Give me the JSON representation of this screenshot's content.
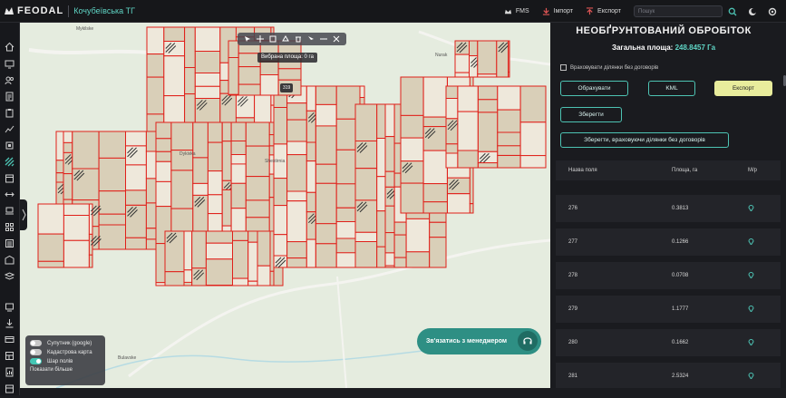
{
  "header": {
    "brand": "FEODAL",
    "region": "Кочубеївська ТГ",
    "nav": [
      {
        "label": "FMS",
        "icon": "crown-icon"
      },
      {
        "label": "Імпорт",
        "icon": "import-icon"
      },
      {
        "label": "Експорт",
        "icon": "export-icon"
      }
    ],
    "search_placeholder": "Пошук"
  },
  "map": {
    "labels": [
      "Mykilske",
      "Nurak",
      "Dykivka",
      "Shestirnia",
      "Bulavske"
    ],
    "selected_area_label": "Вибрана площа: 0 га",
    "badge": "319",
    "layers": [
      {
        "label": "Супутник (google)",
        "on": false
      },
      {
        "label": "Кадастрова карта",
        "on": false
      },
      {
        "label": "Шар полів",
        "on": true
      }
    ],
    "show_more": "Показати більше",
    "contact_button": "Зв'язатись з менеджером"
  },
  "panel": {
    "title": "НЕОБҐРУНТОВАНИЙ ОБРОБІТОК",
    "total_label": "Загальна площа:",
    "total_value": "248.8457 Га",
    "checkbox_label": "Враховувати ділянки без договорів",
    "buttons": {
      "calc": "Обрахувати",
      "kml": "KML",
      "export": "Експорт",
      "save": "Зберегти",
      "save_without": "Зберегти, враховуючи ділянки без договорів"
    },
    "columns": [
      "Назва поля",
      "Площа, га",
      "М/р"
    ],
    "rows": [
      {
        "name": "276",
        "area": "0.3813"
      },
      {
        "name": "277",
        "area": "0.1266"
      },
      {
        "name": "278",
        "area": "0.0708"
      },
      {
        "name": "279",
        "area": "1.1777"
      },
      {
        "name": "280",
        "area": "0.1662"
      },
      {
        "name": "281",
        "area": "2.5324"
      }
    ]
  },
  "colors": {
    "accent": "#4dc3b3",
    "field_border": "#e0201a",
    "field_fill": "#d9cfb8",
    "export_btn": "#e8ec9c"
  }
}
